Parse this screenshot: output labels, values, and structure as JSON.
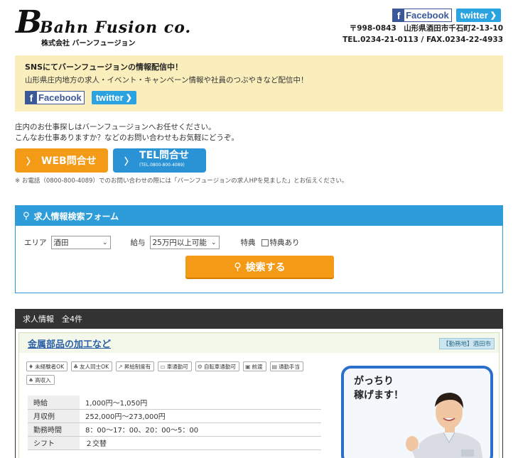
{
  "header": {
    "logo_b": "B",
    "logo_name": "Bahn Fusion co.",
    "logo_sub": "株式会社 バーンフュージョン",
    "facebook_label": "Facebook",
    "twitter_label": "twitter",
    "address": "〒998-0843　山形県酒田市千石町2-13-10",
    "phone": "TEL.0234-21-0113 / FAX.0234-22-4933"
  },
  "banner": {
    "title": "SNSにてバーンフュージョンの情報配信中！",
    "text": "山形県庄内地方の求人・イベント・キャンペーン情報や社員のつぶやきなど配信中！",
    "facebook_label": "Facebook",
    "twitter_label": "twitter"
  },
  "intro": {
    "line1": "庄内のお仕事探しはバーンフュージョンへお任せください。",
    "line2": "こんなお仕事ありますか？などのお問い合わせもお気軽にどうぞ。",
    "web_button": "WEB問合せ",
    "tel_button": "TEL問合せ",
    "tel_button_sub": "(TEL.0800-800-4089)",
    "note": "※ お電話（0800-800-4089）でのお問い合わせの際には「バーンフュージョンの求人HPを見ました」とお伝えください。"
  },
  "search": {
    "title": "求人情報検索フォーム",
    "area_label": "エリア",
    "area_value": "酒田",
    "salary_label": "給与",
    "salary_value": "25万円以上可能",
    "perk_label": "特典",
    "perk_checkbox_label": "特典あり",
    "search_button": "検索する"
  },
  "results": {
    "header": "求人情報　全4件",
    "job": {
      "title": "金属部品の加工など",
      "location": "【勤務地】酒田市",
      "tags": [
        "未経験者OK",
        "友人同士OK",
        "昇給制度有",
        "車通勤可",
        "自転車通勤可",
        "前渡",
        "通勤手当",
        "高収入"
      ],
      "rows": [
        {
          "key": "時給",
          "value": "1,000円〜1,050円"
        },
        {
          "key": "月収例",
          "value": "252,000円〜273,000円"
        },
        {
          "key": "勤務時間",
          "value": "8：00〜17：00、20：00〜5：00"
        },
        {
          "key": "シフト",
          "value": "２交替"
        }
      ],
      "promo_line1": "がっちり",
      "promo_line2": "稼げます！"
    }
  }
}
